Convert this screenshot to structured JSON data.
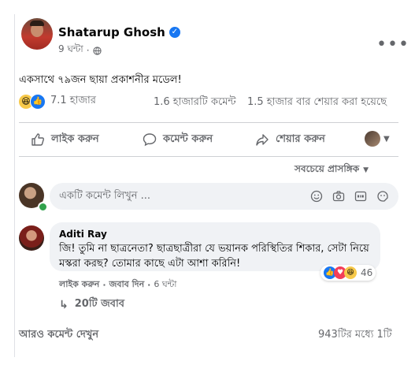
{
  "post": {
    "author": "Shatarup Ghosh",
    "time": "9 ঘন্টা",
    "dot": "·",
    "text": "একসাথে ৭৯জন ছায়া প্রকাশনীর মডেল!",
    "reaction_count": "7.1 হাজার",
    "comments_count": "1.6 হাজারটি কমেন্ট",
    "shares_count": "1.5 হাজার বার শেয়ার করা হয়েছে"
  },
  "actions": {
    "like": "লাইক করুন",
    "comment": "কমেন্ট করুন",
    "share": "শেয়ার করুন"
  },
  "comments_section": {
    "sort_label": "সবচেয়ে প্রাসঙ্গিক",
    "input_placeholder": "একটি কমেন্ট লিখুন ...",
    "more_comments": "আরও কমেন্ট দেখুন",
    "counter": "943টির মধ্যে 1টি"
  },
  "comment": {
    "author": "Aditi Ray",
    "text": "জি! তুমি না ছাত্রনেতা? ছাত্রছাত্রীরা যে ভয়ানক পরিস্থিতির শিকার, সেটা নিয়ে মস্করা করছ? তোমার কাছে এটা আশা করিনি!",
    "like": "লাইক করুন",
    "reply": "জবাব দিন",
    "time": "6 ঘন্টা",
    "dot": "·",
    "reaction_count": "46",
    "replies": "20টি জবাব"
  },
  "colors": {
    "accent": "#1877f2",
    "bubble": "#f0f2f5",
    "online": "#31a24c"
  }
}
